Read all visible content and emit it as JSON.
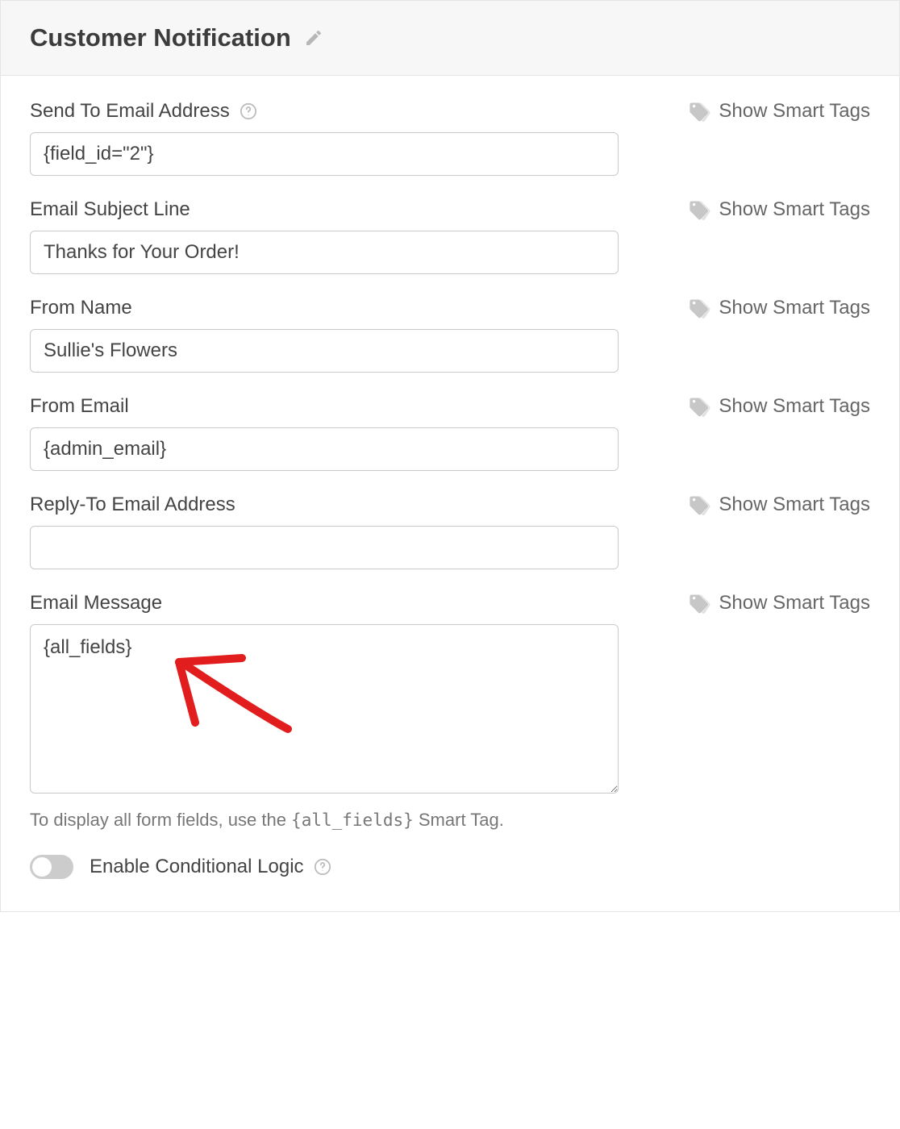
{
  "header": {
    "title": "Customer Notification"
  },
  "smartTagsLabel": "Show Smart Tags",
  "fields": {
    "sendTo": {
      "label": "Send To Email Address",
      "value": "{field_id=\"2\"}"
    },
    "subject": {
      "label": "Email Subject Line",
      "value": "Thanks for Your Order!"
    },
    "fromName": {
      "label": "From Name",
      "value": "Sullie's Flowers"
    },
    "fromEmail": {
      "label": "From Email",
      "value": "{admin_email}"
    },
    "replyTo": {
      "label": "Reply-To Email Address",
      "value": ""
    },
    "message": {
      "label": "Email Message",
      "value": "{all_fields}",
      "helperPrefix": "To display all form fields, use the ",
      "helperCode": "{all_fields}",
      "helperSuffix": " Smart Tag."
    }
  },
  "conditional": {
    "label": "Enable Conditional Logic"
  },
  "annotation": {
    "arrowColor": "#e11d1d"
  }
}
